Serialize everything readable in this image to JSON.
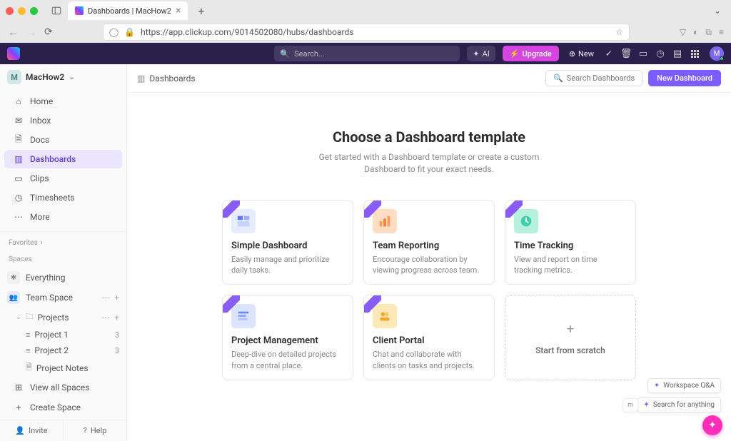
{
  "browser": {
    "tab_title": "Dashboards | MacHow2",
    "url_display": "https://app.clickup.com/9014502080/hubs/dashboards"
  },
  "topbar": {
    "search_placeholder": "Search...",
    "ai_label": "AI",
    "upgrade_label": "Upgrade",
    "new_label": "New",
    "avatar_initial": "M"
  },
  "sidebar": {
    "workspace_name": "MacHow2",
    "workspace_initial": "M",
    "nav": {
      "home": "Home",
      "inbox": "Inbox",
      "docs": "Docs",
      "dashboards": "Dashboards",
      "clips": "Clips",
      "timesheets": "Timesheets",
      "more": "More"
    },
    "sections": {
      "favorites": "Favorites",
      "spaces": "Spaces"
    },
    "spaces": {
      "everything": "Everything",
      "team_space": "Team Space",
      "projects": "Projects",
      "project1": {
        "label": "Project 1",
        "count": "3"
      },
      "project2": {
        "label": "Project 2",
        "count": "3"
      },
      "project_notes": "Project Notes",
      "view_all": "View all Spaces",
      "create": "Create Space"
    },
    "footer": {
      "invite": "Invite",
      "help": "Help"
    }
  },
  "content": {
    "breadcrumb": "Dashboards",
    "search_dashboards": "Search Dashboards",
    "new_dashboard": "New Dashboard",
    "hero_title": "Choose a Dashboard template",
    "hero_subtitle": "Get started with a Dashboard template or create a custom Dashboard to fit your exact needs.",
    "templates": [
      {
        "title": "Simple Dashboard",
        "desc": "Easily manage and prioritize daily tasks."
      },
      {
        "title": "Team Reporting",
        "desc": "Encourage collaboration by viewing progress across team."
      },
      {
        "title": "Time Tracking",
        "desc": "View and report on time tracking metrics."
      },
      {
        "title": "Project Management",
        "desc": "Deep-dive on detailed projects from a central place."
      },
      {
        "title": "Client Portal",
        "desc": "Chat and collaborate with clients on tasks and projects."
      }
    ],
    "scratch_label": "Start from scratch"
  },
  "helpers": {
    "qa": "Workspace Q&A",
    "search": "Search for anything",
    "partial": "m"
  }
}
